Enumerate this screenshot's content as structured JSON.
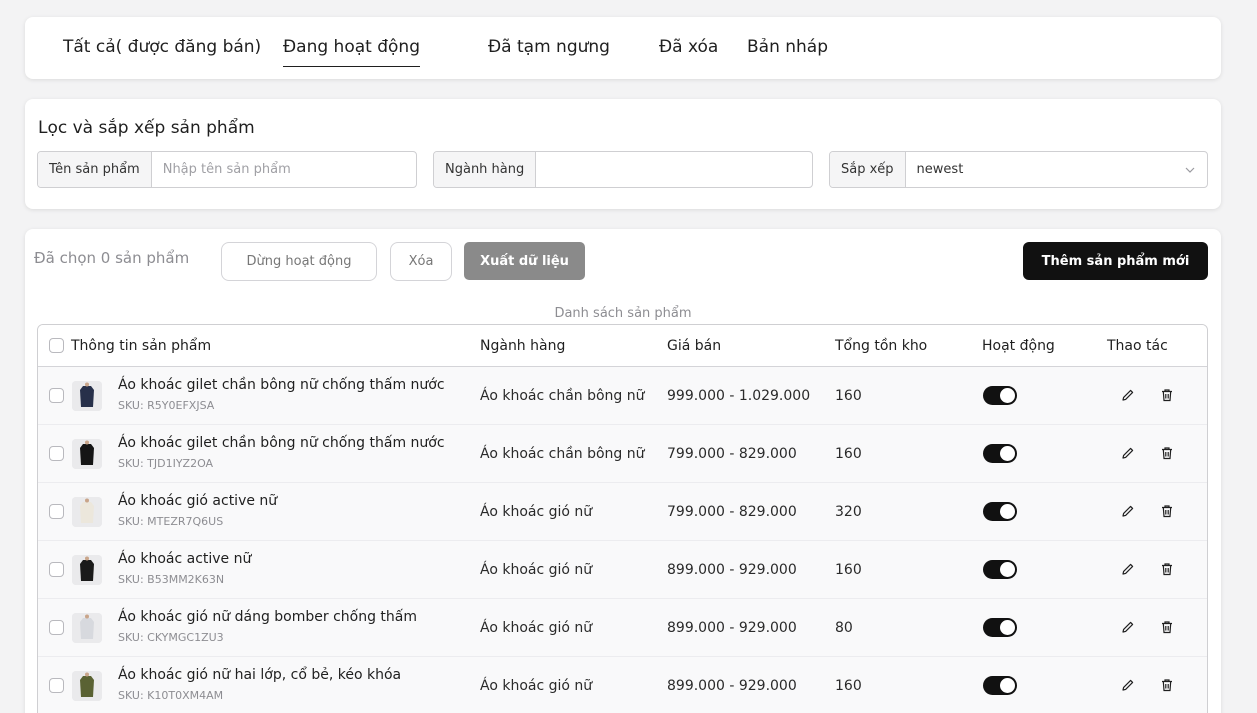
{
  "tabs": [
    {
      "label": "Tất cả( được đăng bán)",
      "active": false
    },
    {
      "label": "Đang hoạt động",
      "active": true
    },
    {
      "label": "Đã tạm ngưng",
      "active": false
    },
    {
      "label": "Đã xóa",
      "active": false
    },
    {
      "label": "Bản nháp",
      "active": false
    }
  ],
  "filter": {
    "title": "Lọc và sắp xếp sản phẩm",
    "name_label": "Tên sản phẩm",
    "name_placeholder": "Nhập tên sản phẩm",
    "category_label": "Ngành hàng",
    "category_value": "",
    "sort_label": "Sắp xếp",
    "sort_value": "newest"
  },
  "actions": {
    "selected_count": "Đã chọn 0 sản phẩm",
    "stop_label": "Dừng hoạt động",
    "delete_label": "Xóa",
    "export_label": "Xuất dữ liệu",
    "add_label": "Thêm sản phẩm mới"
  },
  "table": {
    "caption": "Danh sách sản phẩm",
    "headers": {
      "info": "Thông tin sản phẩm",
      "category": "Ngành hàng",
      "price": "Giá bán",
      "stock": "Tổng tồn kho",
      "active": "Hoạt động",
      "actions": "Thao tác"
    },
    "rows": [
      {
        "name": "Áo khoác gilet chần bông nữ chống thấm nước",
        "sku": "SKU: R5Y0EFXJSA",
        "category": "Áo khoác chần bông nữ",
        "price": "999.000 - 1.029.000",
        "stock": "160",
        "active": true,
        "thumb_color": "#27304a"
      },
      {
        "name": "Áo khoác gilet chần bông nữ chống thấm nước",
        "sku": "SKU: TJD1IYZ2OA",
        "category": "Áo khoác chần bông nữ",
        "price": "799.000 - 829.000",
        "stock": "160",
        "active": true,
        "thumb_color": "#151515"
      },
      {
        "name": "Áo khoác gió active nữ",
        "sku": "SKU: MTEZR7Q6US",
        "category": "Áo khoác gió nữ",
        "price": "799.000 - 829.000",
        "stock": "320",
        "active": true,
        "thumb_color": "#ece7dc"
      },
      {
        "name": "Áo khoác active nữ",
        "sku": "SKU: B53MM2K63N",
        "category": "Áo khoác gió nữ",
        "price": "899.000 - 929.000",
        "stock": "160",
        "active": true,
        "thumb_color": "#1a1a1a"
      },
      {
        "name": "Áo khoác gió nữ dáng bomber chống thấm",
        "sku": "SKU: CKYMGC1ZU3",
        "category": "Áo khoác gió nữ",
        "price": "899.000 - 929.000",
        "stock": "80",
        "active": true,
        "thumb_color": "#d7d9de"
      },
      {
        "name": "Áo khoác gió nữ hai lớp, cổ bẻ, kéo khóa",
        "sku": "SKU: K10T0XM4AM",
        "category": "Áo khoác gió nữ",
        "price": "899.000 - 929.000",
        "stock": "160",
        "active": true,
        "thumb_color": "#5a6233"
      }
    ]
  },
  "icons": {
    "edit": "pencil-icon",
    "delete": "trash-icon",
    "dropdown": "chevron-down-icon"
  }
}
